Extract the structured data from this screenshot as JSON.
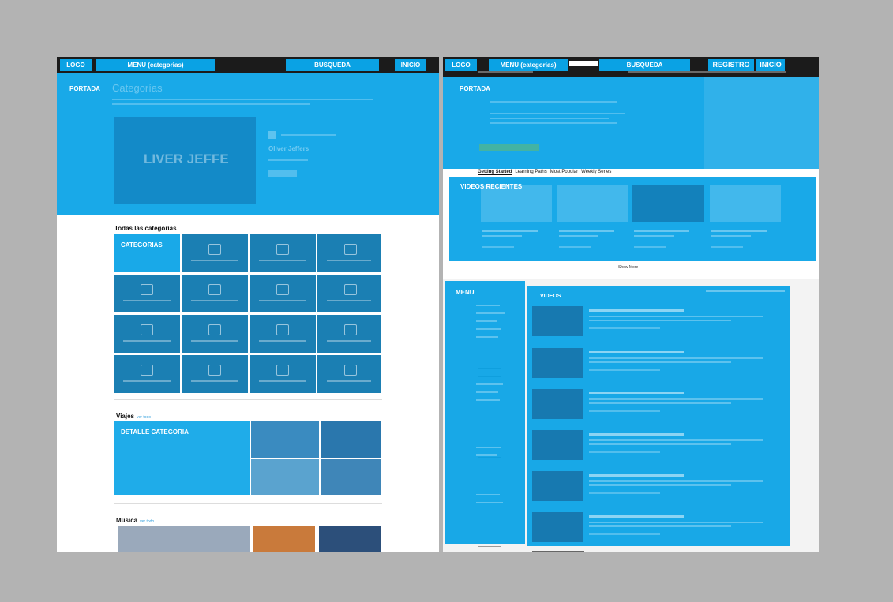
{
  "left_page": {
    "topbar": {
      "logo": "LOGO",
      "menu": "MENU (categorias)",
      "search": "BUSQUEDA",
      "home": "INICIO"
    },
    "hero": {
      "label": "PORTADA",
      "ghost_heading": "Categorías",
      "ghost_name": "Oliver Jeffers",
      "ghost_banner": "LIVER JEFFE"
    },
    "all_categories_title": "Todas las categorías",
    "categories_label": "CATEGORIAS",
    "travel": {
      "title": "Viajes",
      "see_all": "ver todo",
      "detail_label": "DETALLE CATEGORIA"
    },
    "music": {
      "title": "Música",
      "see_all": "ver todo"
    }
  },
  "right_page": {
    "topbar": {
      "logo": "LOGO",
      "menu": "MENU (categorias)",
      "search": "BUSQUEDA",
      "register": "REGISTRO",
      "home": "INICIO"
    },
    "hero": {
      "label": "PORTADA"
    },
    "tabs": [
      "Getting Started",
      "Learning Paths",
      "Most Popular",
      "Weekly Series"
    ],
    "recent_label": "VIDEOS RECIENTES",
    "show_more": "Show More",
    "menu_label": "MENU",
    "videos_label": "VIDEOS"
  },
  "colors": {
    "accent": "#0aa2e4",
    "topbar": "#1b1b1b",
    "background": "#b3b3b3"
  }
}
